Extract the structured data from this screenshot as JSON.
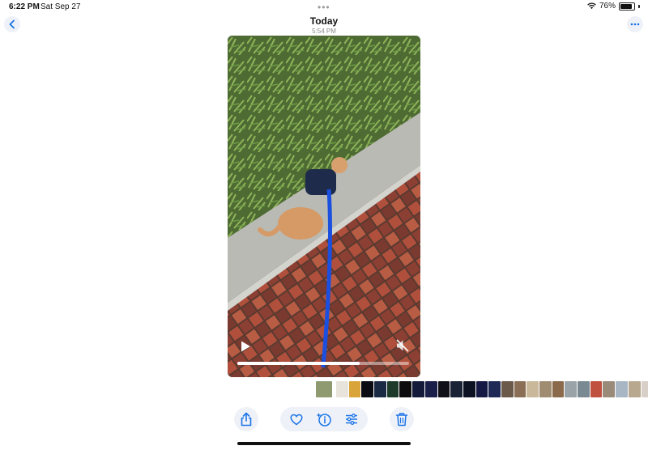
{
  "status_bar": {
    "time": "6:22 PM",
    "date": "Sat Sep 27",
    "multitask": "•••",
    "battery": "76%",
    "battery_level": 0.76,
    "icons": [
      "wifi-icon",
      "battery-icon"
    ]
  },
  "header": {
    "title": "Today",
    "subtitle": "5:54 PM",
    "back_icon": "chevron-left-icon",
    "more_icon": "ellipsis-icon"
  },
  "video": {
    "playback_progress": 0.71,
    "icons": [
      "play-icon",
      "mute-icon"
    ]
  },
  "toolbar": {
    "icons": [
      "share-icon",
      "heart-icon",
      "info-sparkle-icon",
      "adjust-icon",
      "trash-icon"
    ]
  },
  "colors": {
    "accent": "#1a73e8",
    "pill_background": "#eef2f8"
  },
  "thumbnails": {
    "count": 26,
    "current_index": 0
  }
}
